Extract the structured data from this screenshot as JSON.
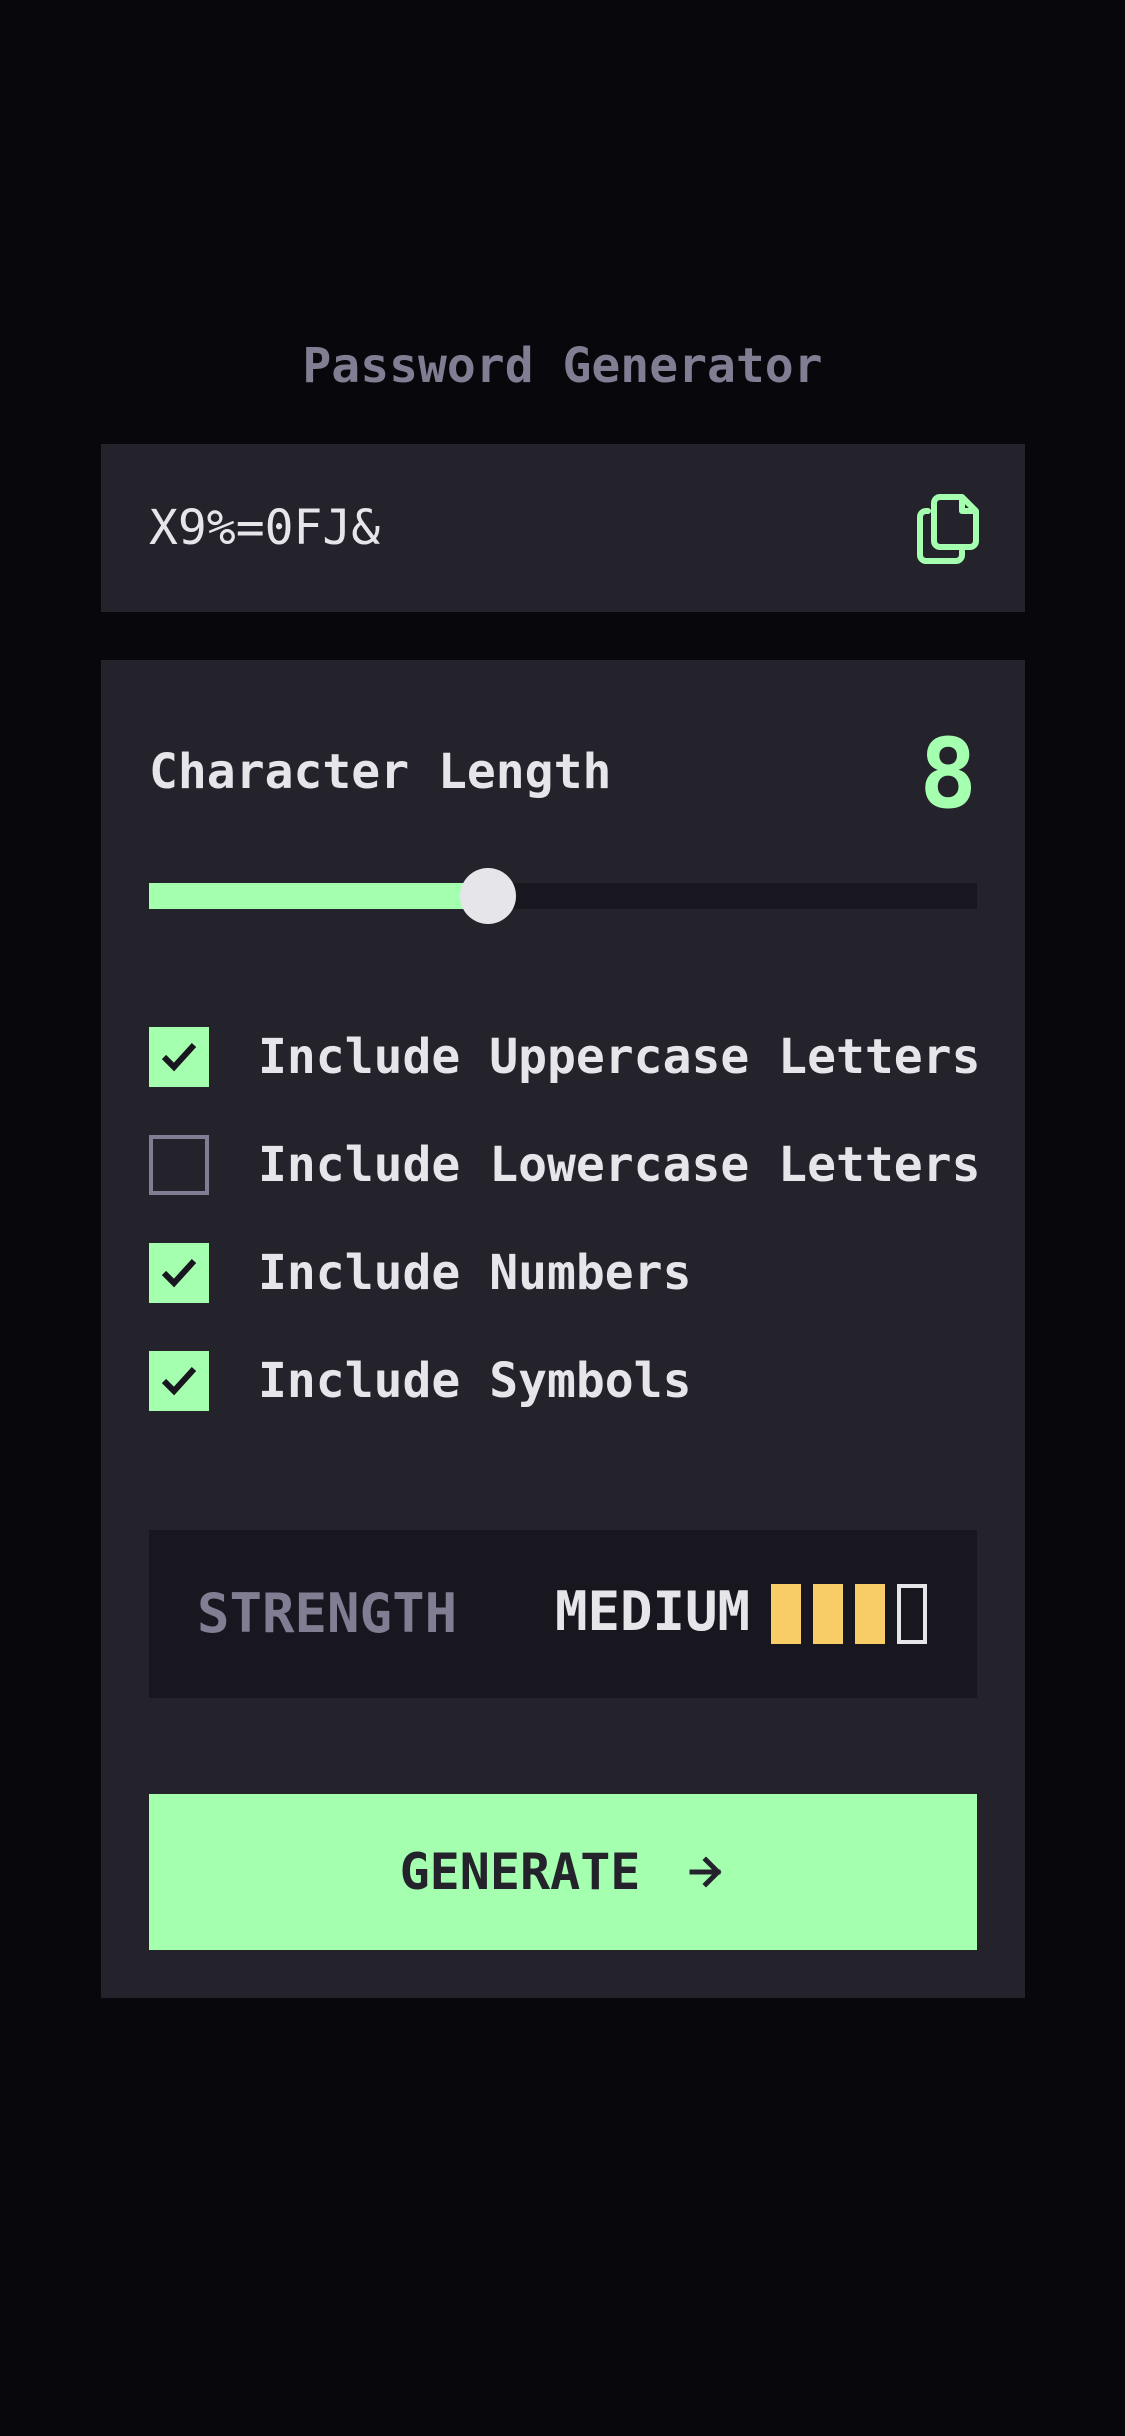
{
  "app": {
    "title": "Password Generator"
  },
  "output": {
    "password": "X9%=0FJ&",
    "copy_icon": "copy-icon"
  },
  "length": {
    "label": "Character Length",
    "value": "8",
    "slider_fraction": 0.41
  },
  "options": [
    {
      "label": "Include Uppercase Letters",
      "checked": true
    },
    {
      "label": "Include Lowercase Letters",
      "checked": false
    },
    {
      "label": "Include Numbers",
      "checked": true
    },
    {
      "label": "Include Symbols",
      "checked": true
    }
  ],
  "strength": {
    "label": "STRENGTH",
    "value": "MEDIUM",
    "level": 3,
    "max_level": 4
  },
  "generate": {
    "label": "GENERATE",
    "icon": "arrow-right-icon"
  },
  "colors": {
    "accent": "#A4FFAF",
    "background": "#08070B",
    "panel": "#24232C",
    "strength_medium": "#F8CD65",
    "muted": "#817D92"
  }
}
